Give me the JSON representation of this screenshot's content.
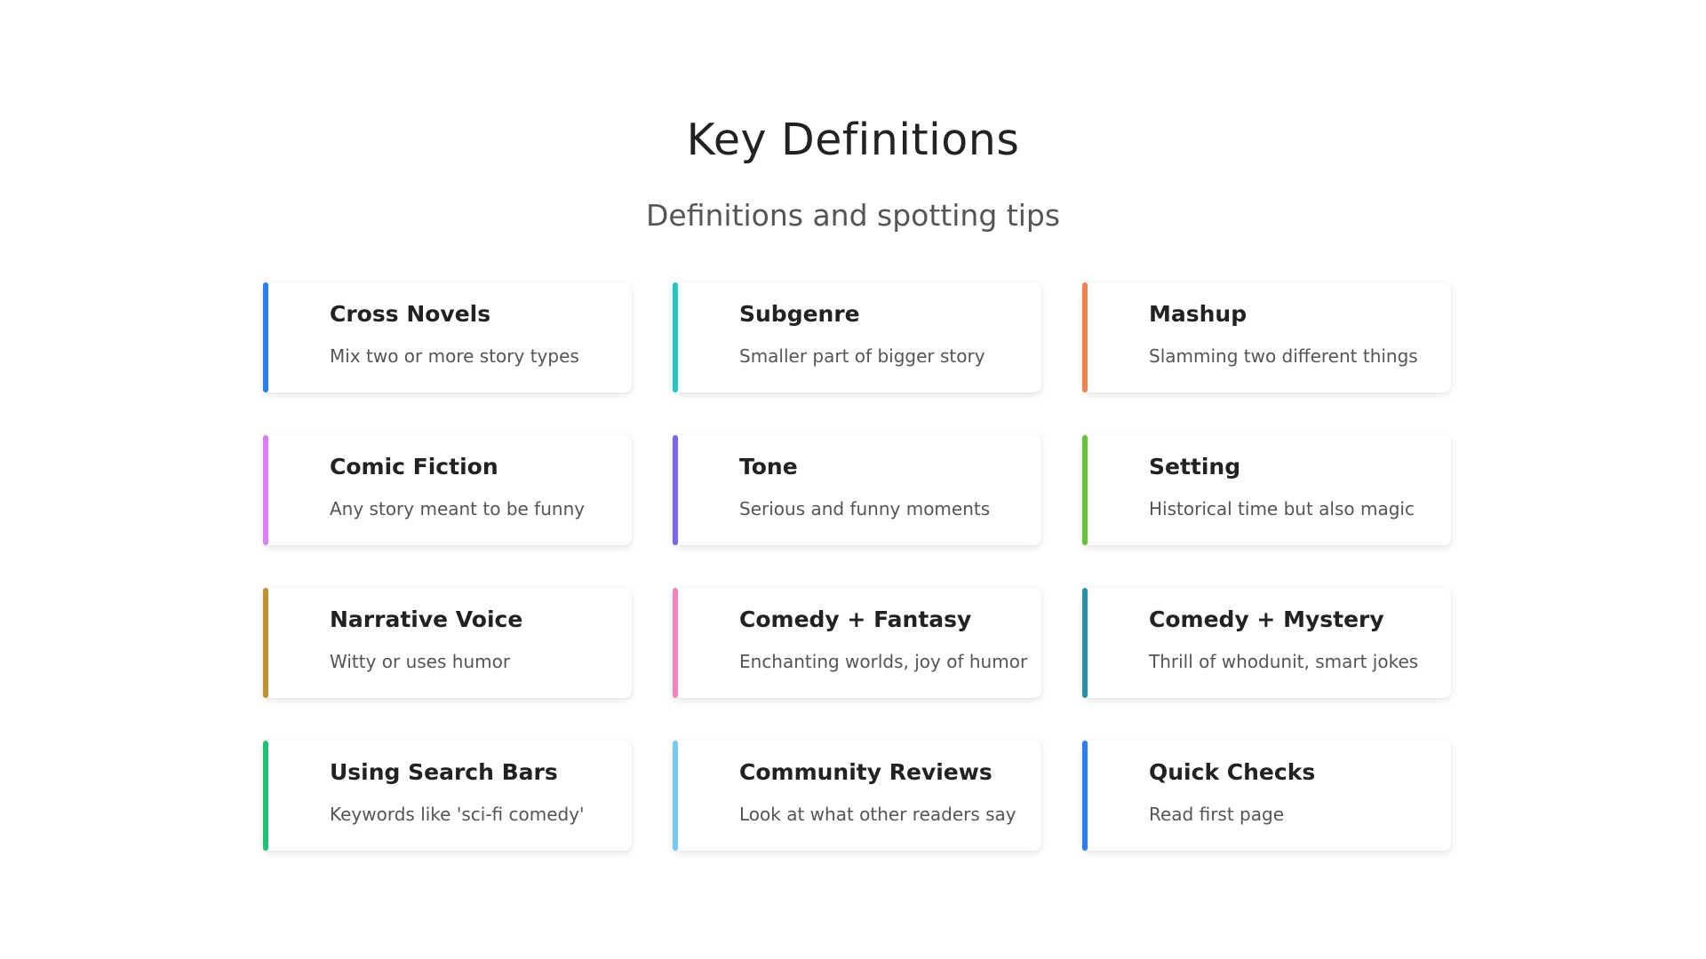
{
  "header": {
    "title": "Key Definitions",
    "subtitle": "Definitions and spotting tips"
  },
  "cards": [
    {
      "title": "Cross Novels",
      "description": "Mix two or more story types",
      "accent": "#2b7ff0"
    },
    {
      "title": "Subgenre",
      "description": "Smaller part of bigger story",
      "accent": "#1fc6c3"
    },
    {
      "title": "Mashup",
      "description": "Slamming two different things",
      "accent": "#ef8350"
    },
    {
      "title": "Comic Fiction",
      "description": "Any story meant to be funny",
      "accent": "#d97ef5"
    },
    {
      "title": "Tone",
      "description": "Serious and funny moments",
      "accent": "#7a64f0"
    },
    {
      "title": "Setting",
      "description": "Historical time but also magic",
      "accent": "#62c437"
    },
    {
      "title": "Narrative Voice",
      "description": "Witty or uses humor",
      "accent": "#c0922e"
    },
    {
      "title": "Comedy + Fantasy",
      "description": "Enchanting worlds, joy of humor",
      "accent": "#f584c3"
    },
    {
      "title": "Comedy + Mystery",
      "description": "Thrill of whodunit, smart jokes",
      "accent": "#2a90a5"
    },
    {
      "title": "Using Search Bars",
      "description": "Keywords like 'sci-fi comedy'",
      "accent": "#20c177"
    },
    {
      "title": "Community Reviews",
      "description": "Look at what other readers say",
      "accent": "#77c8f3"
    },
    {
      "title": "Quick Checks",
      "description": "Read first page",
      "accent": "#2b7ff0"
    }
  ]
}
